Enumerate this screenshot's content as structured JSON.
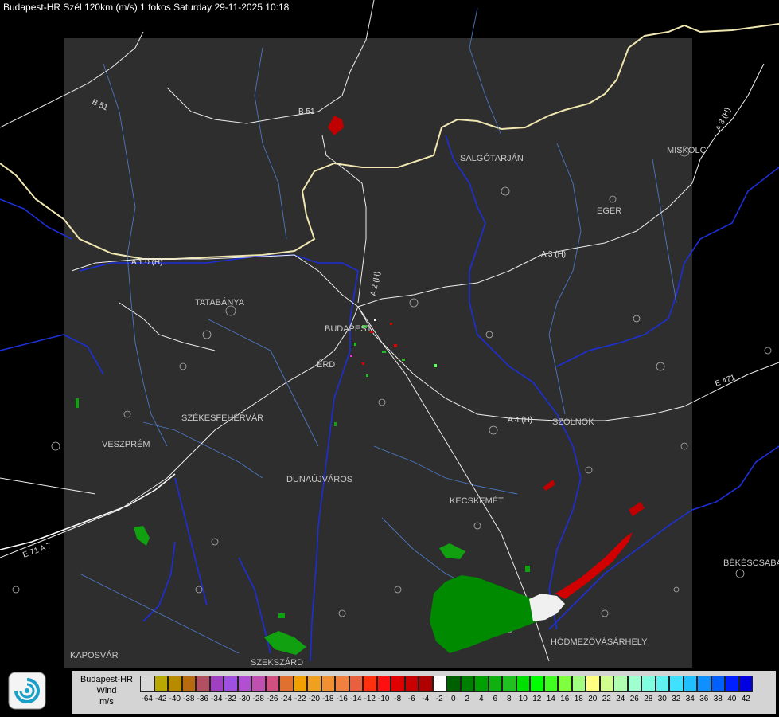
{
  "title": "Budapest-HR Szél 120km (m/s) 1 fokos Saturday 29-11-2025 10:18",
  "legend": {
    "label_lines": [
      "Budapest-HR",
      "Wind",
      "m/s"
    ],
    "ticks": [
      "-64",
      "-42",
      "-40",
      "-38",
      "-36",
      "-34",
      "-32",
      "-30",
      "-28",
      "-26",
      "-24",
      "-22",
      "-20",
      "-18",
      "-16",
      "-14",
      "-12",
      "-10",
      "-8",
      "-6",
      "-4",
      "-2",
      "0",
      "2",
      "4",
      "6",
      "8",
      "10",
      "12",
      "14",
      "16",
      "18",
      "20",
      "22",
      "24",
      "26",
      "28",
      "30",
      "32",
      "34",
      "36",
      "38",
      "40",
      "42"
    ],
    "colors": [
      "#d8d8d8",
      "#b8a800",
      "#b88a00",
      "#b86a10",
      "#b05060",
      "#a040c0",
      "#a050e0",
      "#b050d0",
      "#c050b0",
      "#d05080",
      "#e07030",
      "#f0a000",
      "#f0a020",
      "#f09030",
      "#f08040",
      "#e86040",
      "#ff3010",
      "#ff1010",
      "#e00000",
      "#c80000",
      "#b00000",
      "#ffffff",
      "#006000",
      "#008000",
      "#00a000",
      "#10b010",
      "#20c020",
      "#00e000",
      "#00ff00",
      "#40ff20",
      "#80ff40",
      "#a0ff80",
      "#ffff80",
      "#d0ff90",
      "#b0ffb0",
      "#a0ffd0",
      "#80ffe0",
      "#60f0f0",
      "#40e0ff",
      "#20c0ff",
      "#1090ff",
      "#0060ff",
      "#0020ff",
      "#0000e0"
    ]
  },
  "map": {
    "cities": [
      "SALGÓTARJÁN",
      "MISKOLC",
      "EGER",
      "TATABÁNYA",
      "BUDAPEST",
      "ÉRD",
      "SZÉKESFEHÉRVÁR",
      "VESZPRÉM",
      "DUNAÚJVÁROS",
      "KECSKEMÉT",
      "SZOLNOK",
      "BÉKÉSCSABA",
      "HÓDMEZŐVÁSÁRHELY",
      "KAPOSVÁR",
      "SZEKSZÁRD"
    ],
    "roads": [
      "B 51",
      "B 51",
      "A 3 (H)",
      "A 3 (H)",
      "A 1 0 (H)",
      "A 2 (H)",
      "A 4 (H)",
      "E 471",
      "E 71 A 7"
    ],
    "wind_colors": {
      "approaching": "#00a000",
      "receding": "#d00000",
      "zero": "#ffffff"
    }
  }
}
